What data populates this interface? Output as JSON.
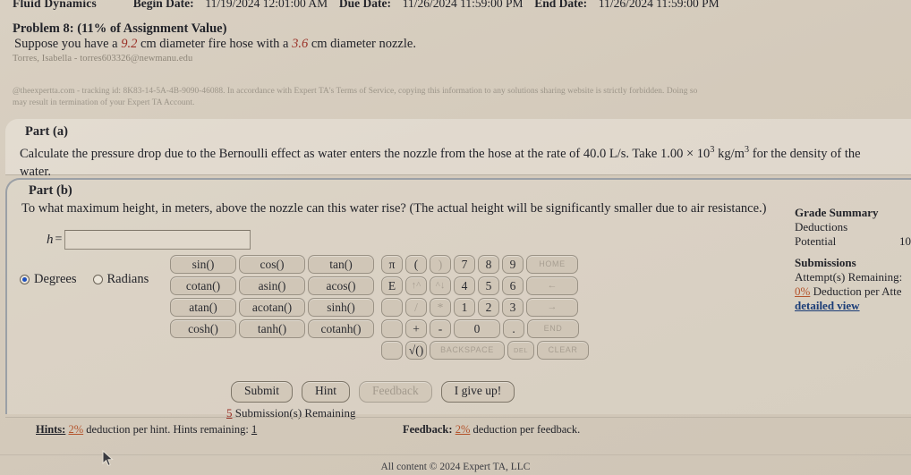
{
  "header": {
    "course_title": "Fluid Dynamics",
    "begin_label": "Begin Date:",
    "begin_value": "11/19/2024 12:01:00 AM",
    "due_label": "Due Date:",
    "due_value": "11/26/2024 11:59:00 PM",
    "end_label": "End Date:",
    "end_value": "11/26/2024 11:59:00 PM"
  },
  "problem": {
    "title": "Problem 8: (11% of Assignment Value)",
    "statement_pre": "Suppose you have a ",
    "hose_diameter": "9.2",
    "statement_mid": " cm diameter fire hose with a ",
    "nozzle_diameter": "3.6",
    "statement_post": " cm diameter nozzle.",
    "student": "Torres, Isabella - torres603326@newmanu.edu",
    "disclaimer_line1": "@theexpertta.com - tracking id: 8K83-14-5A-4B-9090-46088. In accordance with Expert TA's Terms of Service, copying this information to any solutions sharing website is strictly forbidden. Doing so",
    "disclaimer_line2": "may result in termination of your Expert TA Account."
  },
  "part_a": {
    "label": "Part (a)",
    "text_1": "Calculate the pressure drop due to the Bernoulli effect as water enters the nozzle from the hose at the rate of 40.0 L/s. Take 1.00 × 10",
    "exp": "3",
    "text_2": " kg/m",
    "exp2": "3",
    "text_3": " for the density of the",
    "text_4": "water."
  },
  "part_b": {
    "label": "Part (b)",
    "text": "To what maximum height, in meters, above the nozzle can this water rise? (The actual height will be significantly smaller due to air resistance.)",
    "answer_variable": "h",
    "answer_equals": "=",
    "answer_value": "",
    "answer_placeholder": ""
  },
  "keypad": {
    "functions": [
      [
        "sin()",
        "cos()",
        "tan()"
      ],
      [
        "cotan()",
        "asin()",
        "acos()"
      ],
      [
        "atan()",
        "acotan()",
        "sinh()"
      ],
      [
        "cosh()",
        "tanh()",
        "cotanh()"
      ]
    ],
    "numeric": [
      [
        "π",
        "(",
        ")",
        "7",
        "8",
        "9",
        "HOME"
      ],
      [
        "E",
        "↑^",
        "^↓",
        "4",
        "5",
        "6",
        "←"
      ],
      [
        "",
        "/",
        "*",
        "1",
        "2",
        "3",
        "→"
      ],
      [
        "",
        "+",
        "-",
        "0",
        ".",
        "END"
      ],
      [
        "",
        "√()",
        "BACKSPACE",
        "DEL",
        "CLEAR"
      ]
    ],
    "angle_modes": [
      {
        "label": "Degrees",
        "selected": true
      },
      {
        "label": "Radians",
        "selected": false
      }
    ]
  },
  "actions": {
    "submit": "Submit",
    "hint": "Hint",
    "feedback": "Feedback",
    "give_up": "I give up!",
    "submissions_count": "5",
    "submissions_text": " Submission(s) Remaining"
  },
  "grade_summary": {
    "title": "Grade Summary",
    "deductions_label": "Deductions",
    "deductions_value": "",
    "potential_label": "Potential",
    "potential_value": "10",
    "submissions_title": "Submissions",
    "attempts_label": "Attempt(s) Remaining:",
    "attempts_value": "",
    "deduction_pct": "0%",
    "deduction_text": " Deduction per Atte",
    "detailed_view": "detailed view"
  },
  "footer": {
    "hints_label": "Hints:",
    "hints_pct": "2%",
    "hints_text": " deduction per hint. Hints remaining: ",
    "hints_remaining": "1",
    "feedback_label": "Feedback:",
    "feedback_pct": "2%",
    "feedback_text": " deduction per feedback.",
    "copyright": "All content © 2024 Expert TA, LLC"
  },
  "colors": {
    "background": "#d4cabb",
    "key_face": "#d0c6b7",
    "accent_red": "#9a3026",
    "link_blue": "#1b3d77",
    "radio_blue": "#1d4fbe"
  }
}
